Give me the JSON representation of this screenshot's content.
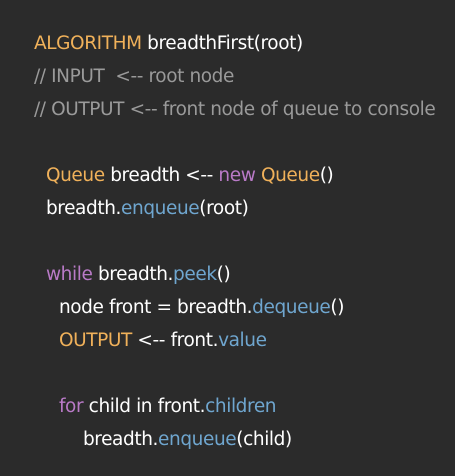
{
  "code": {
    "lines": [
      [
        {
          "t": "ALGORITHM",
          "c": "kw-orange"
        },
        {
          "t": " breadthFirst(root)",
          "c": "plain"
        }
      ],
      [
        {
          "t": "// INPUT  <-- root node",
          "c": "comment"
        }
      ],
      [
        {
          "t": "// OUTPUT <-- front node of queue to console",
          "c": "comment"
        }
      ],
      [],
      [
        {
          "t": "Queue",
          "c": "kw-orange"
        },
        {
          "t": " breadth <-- ",
          "c": "plain"
        },
        {
          "t": "new",
          "c": "kw-purple"
        },
        {
          "t": " ",
          "c": "plain"
        },
        {
          "t": "Queue",
          "c": "kw-orange"
        },
        {
          "t": "()",
          "c": "plain"
        }
      ],
      [
        {
          "t": "breadth.",
          "c": "plain"
        },
        {
          "t": "enqueue",
          "c": "method"
        },
        {
          "t": "(root)",
          "c": "plain"
        }
      ],
      [],
      [
        {
          "t": "while",
          "c": "kw-purple"
        },
        {
          "t": " breadth.",
          "c": "plain"
        },
        {
          "t": "peek",
          "c": "method"
        },
        {
          "t": "()",
          "c": "plain"
        }
      ],
      [
        {
          "t": "node front = breadth.",
          "c": "plain"
        },
        {
          "t": "dequeue",
          "c": "method"
        },
        {
          "t": "()",
          "c": "plain"
        }
      ],
      [
        {
          "t": "OUTPUT",
          "c": "kw-orange"
        },
        {
          "t": " <-- front.",
          "c": "plain"
        },
        {
          "t": "value",
          "c": "method"
        }
      ],
      [],
      [
        {
          "t": "for",
          "c": "kw-purple"
        },
        {
          "t": " child in front.",
          "c": "plain"
        },
        {
          "t": "children",
          "c": "method"
        }
      ],
      [
        {
          "t": "breadth.",
          "c": "plain"
        },
        {
          "t": "enqueue",
          "c": "method"
        },
        {
          "t": "(child)",
          "c": "plain"
        }
      ]
    ]
  },
  "colors": {
    "background": "#2b2b2b",
    "keyword_orange": "#f0b15a",
    "keyword_purple": "#b97ac7",
    "method_blue": "#6fa6cf",
    "comment_gray": "#9a9a9a",
    "plain_text": "#ffffff"
  }
}
